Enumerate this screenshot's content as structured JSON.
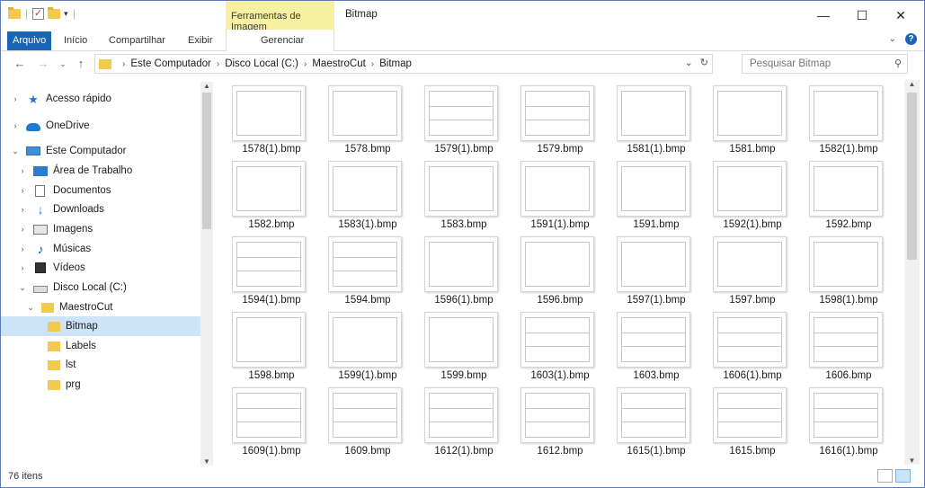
{
  "window": {
    "title": "Bitmap",
    "contextual_tab_group": "Ferramentas de Imagem",
    "controls": {
      "minimize": "—",
      "maximize": "☐",
      "close": "✕"
    }
  },
  "ribbon": {
    "tabs": [
      "Arquivo",
      "Início",
      "Compartilhar",
      "Exibir",
      "Gerenciar"
    ],
    "active_tab": "Arquivo",
    "accent_color": "#1a64b4",
    "contextual_color": "#f6f0a0"
  },
  "address_bar": {
    "breadcrumbs": [
      "Este Computador",
      "Disco Local (C:)",
      "MaestroCut",
      "Bitmap"
    ],
    "search_placeholder": "Pesquisar Bitmap"
  },
  "sidebar": {
    "items": [
      {
        "label": "Acesso rápido",
        "icon": "star-icon",
        "expanded": false,
        "indent": 0
      },
      {
        "label": "OneDrive",
        "icon": "cloud-icon",
        "expanded": false,
        "indent": 0
      },
      {
        "label": "Este Computador",
        "icon": "computer-icon",
        "expanded": true,
        "indent": 0
      },
      {
        "label": "Área de Trabalho",
        "icon": "desktop-icon",
        "expanded": false,
        "indent": 1
      },
      {
        "label": "Documentos",
        "icon": "document-icon",
        "expanded": false,
        "indent": 1
      },
      {
        "label": "Downloads",
        "icon": "download-icon",
        "expanded": false,
        "indent": 1
      },
      {
        "label": "Imagens",
        "icon": "image-icon",
        "expanded": false,
        "indent": 1
      },
      {
        "label": "Músicas",
        "icon": "music-icon",
        "expanded": false,
        "indent": 1
      },
      {
        "label": "Vídeos",
        "icon": "video-icon",
        "expanded": false,
        "indent": 1
      },
      {
        "label": "Disco Local (C:)",
        "icon": "drive-icon",
        "expanded": true,
        "indent": 1
      },
      {
        "label": "MaestroCut",
        "icon": "folder-icon",
        "expanded": true,
        "indent": 2
      },
      {
        "label": "Bitmap",
        "icon": "folder-icon",
        "selected": true,
        "indent": 3
      },
      {
        "label": "Labels",
        "icon": "folder-icon",
        "indent": 3
      },
      {
        "label": "lst",
        "icon": "folder-icon",
        "indent": 3
      },
      {
        "label": "prg",
        "icon": "folder-icon",
        "indent": 3
      }
    ]
  },
  "files": [
    {
      "name": "1578(1).bmp",
      "thumb": "plain"
    },
    {
      "name": "1578.bmp",
      "thumb": "plain"
    },
    {
      "name": "1579(1).bmp",
      "thumb": "band"
    },
    {
      "name": "1579.bmp",
      "thumb": "band"
    },
    {
      "name": "1581(1).bmp",
      "thumb": "plain"
    },
    {
      "name": "1581.bmp",
      "thumb": "plain"
    },
    {
      "name": "1582(1).bmp",
      "thumb": "plain"
    },
    {
      "name": "1582.bmp",
      "thumb": "plain"
    },
    {
      "name": "1583(1).bmp",
      "thumb": "plain"
    },
    {
      "name": "1583.bmp",
      "thumb": "plain"
    },
    {
      "name": "1591(1).bmp",
      "thumb": "plain"
    },
    {
      "name": "1591.bmp",
      "thumb": "plain"
    },
    {
      "name": "1592(1).bmp",
      "thumb": "plain"
    },
    {
      "name": "1592.bmp",
      "thumb": "plain"
    },
    {
      "name": "1594(1).bmp",
      "thumb": "band"
    },
    {
      "name": "1594.bmp",
      "thumb": "band"
    },
    {
      "name": "1596(1).bmp",
      "thumb": "plain"
    },
    {
      "name": "1596.bmp",
      "thumb": "plain"
    },
    {
      "name": "1597(1).bmp",
      "thumb": "plain"
    },
    {
      "name": "1597.bmp",
      "thumb": "plain"
    },
    {
      "name": "1598(1).bmp",
      "thumb": "plain"
    },
    {
      "name": "1598.bmp",
      "thumb": "plain"
    },
    {
      "name": "1599(1).bmp",
      "thumb": "plain"
    },
    {
      "name": "1599.bmp",
      "thumb": "plain"
    },
    {
      "name": "1603(1).bmp",
      "thumb": "band"
    },
    {
      "name": "1603.bmp",
      "thumb": "band"
    },
    {
      "name": "1606(1).bmp",
      "thumb": "band"
    },
    {
      "name": "1606.bmp",
      "thumb": "band"
    },
    {
      "name": "1609(1).bmp",
      "thumb": "band"
    },
    {
      "name": "1609.bmp",
      "thumb": "band"
    },
    {
      "name": "1612(1).bmp",
      "thumb": "band"
    },
    {
      "name": "1612.bmp",
      "thumb": "band"
    },
    {
      "name": "1615(1).bmp",
      "thumb": "band"
    },
    {
      "name": "1615.bmp",
      "thumb": "band"
    },
    {
      "name": "1616(1).bmp",
      "thumb": "band"
    }
  ],
  "status_bar": {
    "item_count": "76 itens"
  }
}
